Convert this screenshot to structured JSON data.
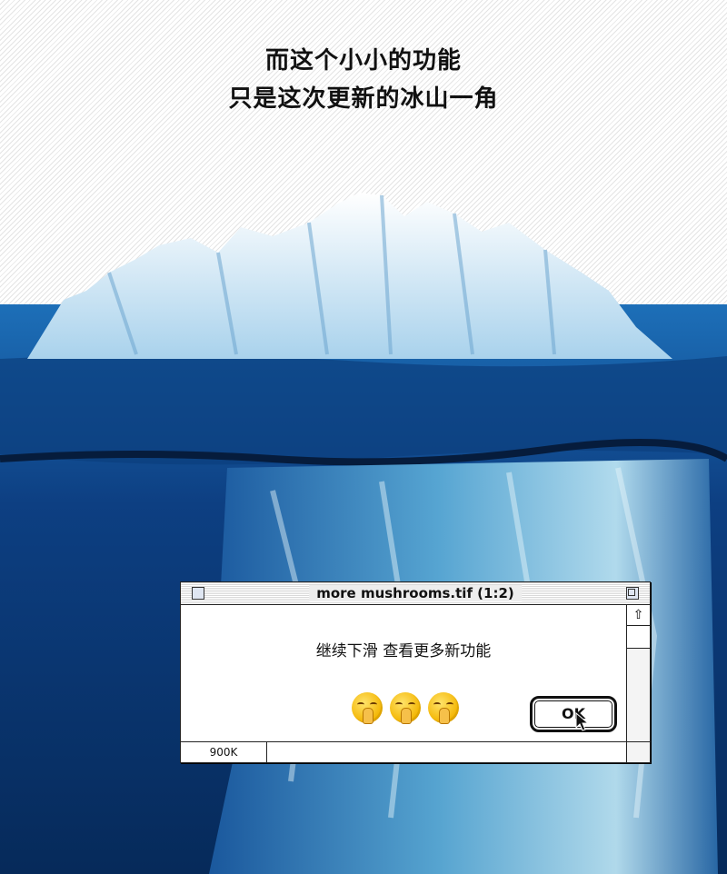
{
  "headline": {
    "line1": "而这个小小的功能",
    "line2": "只是这次更新的冰山一角"
  },
  "dialog": {
    "title": "more mushrooms.tif  (1:2)",
    "message": "继续下滑  查看更多新功能",
    "emoji_icon": "shush-face-icon",
    "emoji_count": 3,
    "ok_label": "OK",
    "status_size": "900K"
  },
  "colors": {
    "sky_hatch": "#e4e4e4",
    "ocean_deep": "#0b2f6b",
    "ocean_surface": "#0f4f96",
    "ice_light": "#e9f4fb",
    "ice_mid": "#8fc4e3",
    "ice_underwater": "#6fb5d8"
  }
}
